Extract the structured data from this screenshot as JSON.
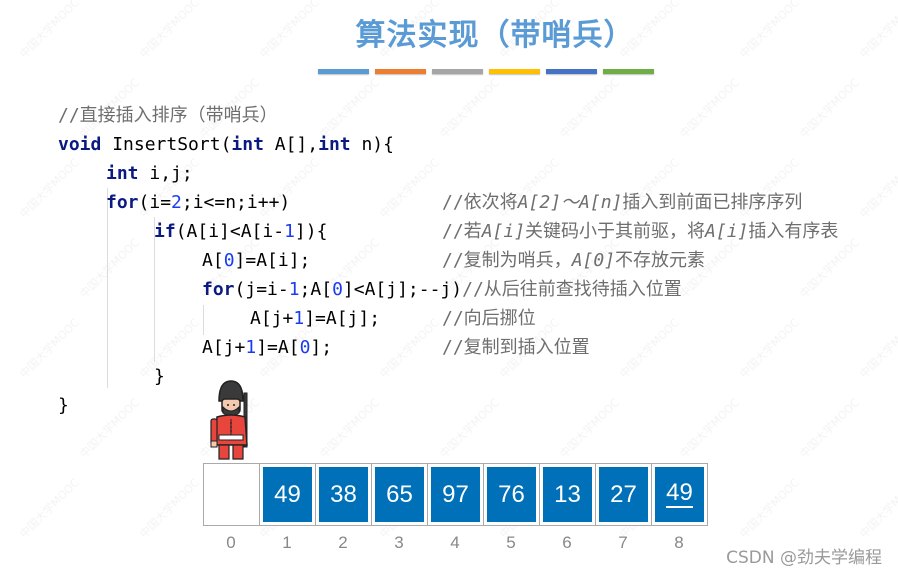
{
  "slide": {
    "title": "算法实现（带哨兵）",
    "accent_colors": [
      "#5b9bd5",
      "#ed7d31",
      "#a5a5a5",
      "#ffc000",
      "#4472c4",
      "#70ad47"
    ],
    "watermark_text": "中国大学MOOC"
  },
  "code": {
    "line0": "//直接插入排序（带哨兵）",
    "line1_kw1": "void",
    "line1_a": " InsertSort(",
    "line1_kw2": "int",
    "line1_b": " A[],",
    "line1_kw3": "int",
    "line1_c": " n){",
    "line2_kw": "int",
    "line2_a": " i,j;",
    "line3_kw": "for",
    "line3_a": "(i=",
    "line3_num": "2",
    "line3_b": ";i<=n;i++)",
    "line3_cmt_a": "//依次将",
    "line3_cmt_i1": "A[2]～A[n]",
    "line3_cmt_b": "插入到前面已排序序列",
    "line4_kw": "if",
    "line4_a": "(A[i]<A[i-",
    "line4_num": "1",
    "line4_b": "]){",
    "line4_cmt_a": "//若",
    "line4_cmt_i1": "A[i]",
    "line4_cmt_b": "关键码小于其前驱，将",
    "line4_cmt_i2": "A[i]",
    "line4_cmt_c": "插入有序表",
    "line5_a": "A[",
    "line5_num": "0",
    "line5_b": "]=A[i];",
    "line5_cmt_a": "//复制为哨兵，",
    "line5_cmt_i1": "A[0]",
    "line5_cmt_b": "不存放元素",
    "line6_kw": "for",
    "line6_a": "(j=i-",
    "line6_num1": "1",
    "line6_b": ";A[",
    "line6_num2": "0",
    "line6_c": "]<A[j];--j)",
    "line6_cmt": "//从后往前查找待插入位置",
    "line7_a": "A[j+",
    "line7_num": "1",
    "line7_b": "]=A[j];",
    "line7_cmt": "//向后挪位",
    "line8_a": "A[j+",
    "line8_num": "1",
    "line8_b": "]=A[",
    "line8_num2": "0",
    "line8_c": "];",
    "line8_cmt": "//复制到插入位置",
    "line9": "}",
    "line10": "}"
  },
  "array": {
    "cells": [
      {
        "index": "0",
        "value": ""
      },
      {
        "index": "1",
        "value": "49"
      },
      {
        "index": "2",
        "value": "38"
      },
      {
        "index": "3",
        "value": "65"
      },
      {
        "index": "4",
        "value": "97"
      },
      {
        "index": "5",
        "value": "76"
      },
      {
        "index": "6",
        "value": "13"
      },
      {
        "index": "7",
        "value": "27"
      },
      {
        "index": "8",
        "value": "49",
        "underlined": true
      }
    ],
    "fill_color": "#0070b8",
    "sentinel_icon": "royal-guard-soldier-icon"
  },
  "credit": "CSDN @劲夫学编程"
}
